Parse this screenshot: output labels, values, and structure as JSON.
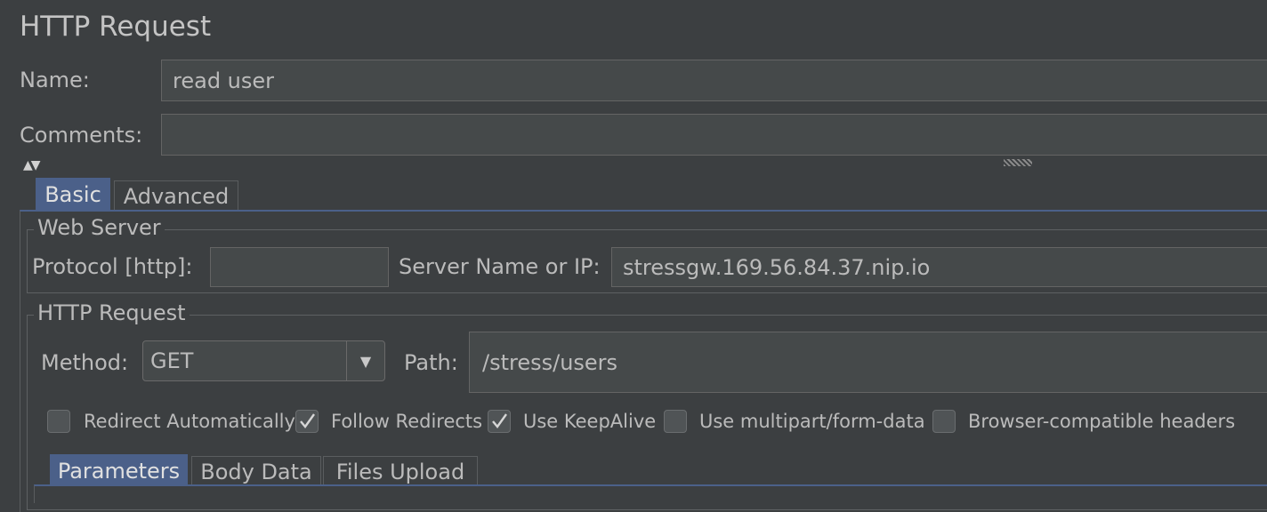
{
  "header": {
    "title": "HTTP Request"
  },
  "form": {
    "name_label": "Name:",
    "name_value": "read user",
    "comments_label": "Comments:",
    "comments_value": ""
  },
  "tabs": [
    {
      "label": "Basic",
      "selected": true
    },
    {
      "label": "Advanced",
      "selected": false
    }
  ],
  "web_server": {
    "title": "Web Server",
    "protocol_label": "Protocol [http]:",
    "protocol_value": "",
    "server_label": "Server Name or IP:",
    "server_value": "stressgw.169.56.84.37.nip.io"
  },
  "http_request": {
    "title": "HTTP Request",
    "method_label": "Method:",
    "method_value": "GET",
    "path_label": "Path:",
    "path_value": "/stress/users",
    "options": [
      {
        "label": "Redirect Automatically",
        "checked": false
      },
      {
        "label": "Follow Redirects",
        "checked": true
      },
      {
        "label": "Use KeepAlive",
        "checked": true
      },
      {
        "label": "Use multipart/form-data",
        "checked": false
      },
      {
        "label": "Browser-compatible headers",
        "checked": false
      }
    ]
  },
  "sub_tabs": [
    {
      "label": "Parameters",
      "selected": true
    },
    {
      "label": "Body Data",
      "selected": false
    },
    {
      "label": "Files Upload",
      "selected": false
    }
  ],
  "colors": {
    "background": "#3c3f41",
    "field": "#45494a",
    "selected_tab": "#4b6089",
    "text": "#bbbbbb"
  },
  "icons": {
    "collapse_expand": "up-down-arrows-icon",
    "dropdown": "chevron-down-icon",
    "check": "check-icon",
    "splitter": "splitter-grip-icon"
  }
}
